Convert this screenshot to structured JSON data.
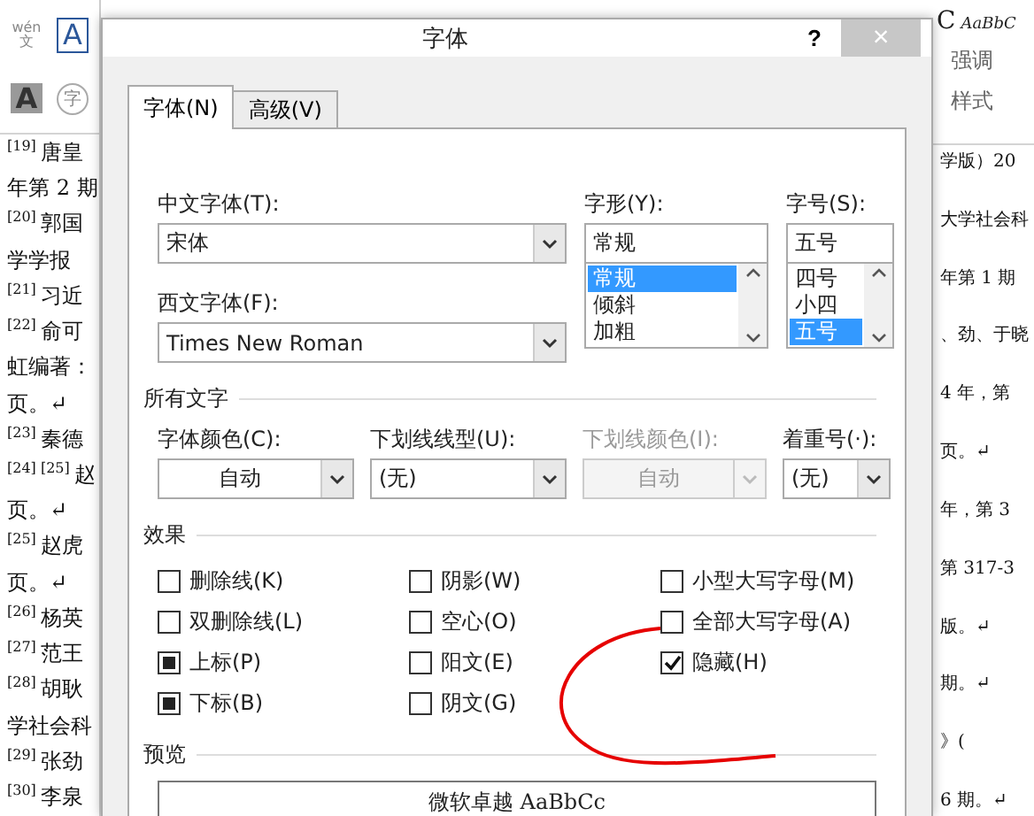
{
  "ribbon_left": {
    "phonetic_top": "wén",
    "phonetic_char": "文",
    "char_border": "A",
    "char_shading": "A",
    "enclose_char": "字"
  },
  "ribbon_right": {
    "style_preview": "C",
    "style_sample": "AaBbC",
    "style_name": "强调",
    "group_label": "样式"
  },
  "document_left": [
    {
      "ref": "[19]",
      "text": "唐皇"
    },
    {
      "text": "年第 2 期"
    },
    {
      "ref": "[20]",
      "text": "郭国"
    },
    {
      "text": "学学报"
    },
    {
      "ref": "[21]",
      "text": "习近"
    },
    {
      "ref": "[22]",
      "text": "俞可"
    },
    {
      "text": "虹编著："
    },
    {
      "text": "页。↵"
    },
    {
      "ref": "[23]",
      "text": "秦德"
    },
    {
      "ref": "[24] [25]",
      "text": "赵"
    },
    {
      "text": "页。↵"
    },
    {
      "ref": "[25]",
      "text": "赵虎"
    },
    {
      "text": "页。↵"
    },
    {
      "ref": "[26]",
      "text": "杨英"
    },
    {
      "ref": "[27]",
      "text": "范王"
    },
    {
      "ref": "[28]",
      "text": "胡耿"
    },
    {
      "text": "学社会科"
    },
    {
      "ref": "[29]",
      "text": "张劲"
    },
    {
      "ref": "[30]",
      "text": "李泉"
    }
  ],
  "document_right": [
    "学版）20",
    "大学社会科",
    "年第 1 期",
    "、劲、于晓",
    "4 年，第",
    "页。↵",
    "年，第 3",
    "第 317-3",
    "版。↵",
    "期。↵",
    "》(",
    "6 期。↵"
  ],
  "dialog": {
    "title": "字体",
    "help": "?",
    "close": "×",
    "tabs": [
      {
        "label": "字体(N)",
        "selected": true
      },
      {
        "label": "高级(V)",
        "selected": false
      }
    ],
    "chinese_font": {
      "label": "中文字体(T):",
      "value": "宋体"
    },
    "western_font": {
      "label": "西文字体(F):",
      "value": "Times New Roman"
    },
    "style": {
      "label": "字形(Y):",
      "value": "常规",
      "options": [
        {
          "label": "常规",
          "selected": true
        },
        {
          "label": "倾斜",
          "selected": false
        },
        {
          "label": "加粗",
          "selected": false
        }
      ]
    },
    "size": {
      "label": "字号(S):",
      "value": "五号",
      "options": [
        {
          "label": "四号",
          "selected": false
        },
        {
          "label": "小四",
          "selected": false
        },
        {
          "label": "五号",
          "selected": true
        }
      ]
    },
    "all_text": {
      "heading": "所有文字",
      "fields": [
        {
          "kind": "color",
          "label": "字体颜色(C):",
          "value": "自动",
          "disabled": false
        },
        {
          "kind": "list",
          "label": "下划线线型(U):",
          "value": "(无)",
          "disabled": false
        },
        {
          "kind": "color",
          "label": "下划线颜色(I):",
          "value": "自动",
          "disabled": true
        },
        {
          "kind": "list",
          "label": "着重号(·):",
          "value": "(无)",
          "disabled": false
        }
      ]
    },
    "effects": {
      "heading": "效果",
      "columns": [
        [
          {
            "label": "删除线(K)",
            "checked": false,
            "partial": false
          },
          {
            "label": "双删除线(L)",
            "checked": false,
            "partial": false
          },
          {
            "label": "上标(P)",
            "checked": false,
            "partial": true
          },
          {
            "label": "下标(B)",
            "checked": false,
            "partial": true
          }
        ],
        [
          {
            "label": "阴影(W)",
            "checked": false,
            "partial": false
          },
          {
            "label": "空心(O)",
            "checked": false,
            "partial": false
          },
          {
            "label": "阳文(E)",
            "checked": false,
            "partial": false
          },
          {
            "label": "阴文(G)",
            "checked": false,
            "partial": false
          }
        ],
        [
          {
            "label": "小型大写字母(M)",
            "checked": false,
            "partial": false
          },
          {
            "label": "全部大写字母(A)",
            "checked": false,
            "partial": false
          },
          {
            "label": "隐藏(H)",
            "checked": true,
            "partial": false
          }
        ]
      ]
    },
    "annotation": {
      "kind": "circle"
    },
    "preview": {
      "heading": "预览",
      "sample": "微软卓越 AaBbCc"
    }
  }
}
